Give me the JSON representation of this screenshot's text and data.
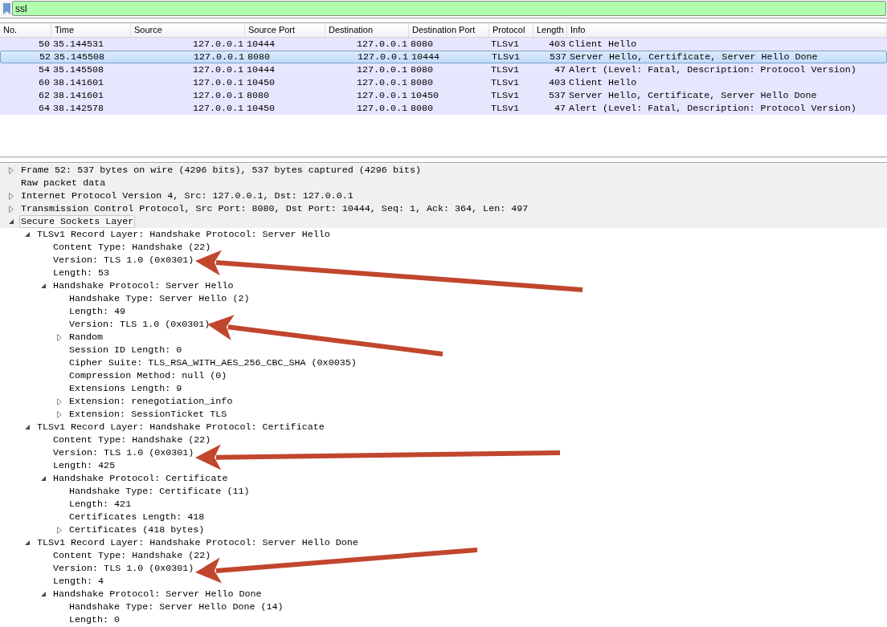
{
  "filter": {
    "value": "ssl"
  },
  "packet_list": {
    "columns": [
      "No.",
      "Time",
      "Source",
      "Source Port",
      "Destination",
      "Destination Port",
      "Protocol",
      "Length",
      "Info"
    ],
    "rows": [
      {
        "selected": false,
        "cells": [
          "50",
          "35.144531",
          "127.0.0.1",
          "10444",
          "127.0.0.1",
          "8080",
          "TLSv1",
          "403",
          "Client Hello"
        ]
      },
      {
        "selected": true,
        "cells": [
          "52",
          "35.145508",
          "127.0.0.1",
          "8080",
          "127.0.0.1",
          "10444",
          "TLSv1",
          "537",
          "Server Hello, Certificate, Server Hello Done"
        ]
      },
      {
        "selected": false,
        "cells": [
          "54",
          "35.145508",
          "127.0.0.1",
          "10444",
          "127.0.0.1",
          "8080",
          "TLSv1",
          "47",
          "Alert (Level: Fatal, Description: Protocol Version)"
        ]
      },
      {
        "selected": false,
        "cells": [
          "60",
          "38.141601",
          "127.0.0.1",
          "10450",
          "127.0.0.1",
          "8080",
          "TLSv1",
          "403",
          "Client Hello"
        ]
      },
      {
        "selected": false,
        "cells": [
          "62",
          "38.141601",
          "127.0.0.1",
          "8080",
          "127.0.0.1",
          "10450",
          "TLSv1",
          "537",
          "Server Hello, Certificate, Server Hello Done"
        ]
      },
      {
        "selected": false,
        "cells": [
          "64",
          "38.142578",
          "127.0.0.1",
          "10450",
          "127.0.0.1",
          "8080",
          "TLSv1",
          "47",
          "Alert (Level: Fatal, Description: Protocol Version)"
        ]
      }
    ]
  },
  "packet_details": [
    {
      "label": "Frame 52: 537 bytes on wire (4296 bits), 537 bytes captured (4296 bits)",
      "expanded": false,
      "selected": false
    },
    {
      "label": "Raw packet data",
      "selected": false
    },
    {
      "label": "Internet Protocol Version 4, Src: 127.0.0.1, Dst: 127.0.0.1",
      "expanded": false,
      "selected": false
    },
    {
      "label": "Transmission Control Protocol, Src Port: 8080, Dst Port: 10444, Seq: 1, Ack: 364, Len: 497",
      "expanded": false,
      "selected": false
    },
    {
      "label": "Secure Sockets Layer",
      "expanded": true,
      "selected": true,
      "children": [
        {
          "label": "TLSv1 Record Layer: Handshake Protocol: Server Hello",
          "expanded": true,
          "children": [
            {
              "label": "Content Type: Handshake (22)"
            },
            {
              "label": "Version: TLS 1.0 (0x0301)"
            },
            {
              "label": "Length: 53"
            },
            {
              "label": "Handshake Protocol: Server Hello",
              "expanded": true,
              "children": [
                {
                  "label": "Handshake Type: Server Hello (2)"
                },
                {
                  "label": "Length: 49"
                },
                {
                  "label": "Version: TLS 1.0 (0x0301)"
                },
                {
                  "label": "Random",
                  "expanded": false
                },
                {
                  "label": "Session ID Length: 0"
                },
                {
                  "label": "Cipher Suite: TLS_RSA_WITH_AES_256_CBC_SHA (0x0035)"
                },
                {
                  "label": "Compression Method: null (0)"
                },
                {
                  "label": "Extensions Length: 9"
                },
                {
                  "label": "Extension: renegotiation_info",
                  "expanded": false
                },
                {
                  "label": "Extension: SessionTicket TLS",
                  "expanded": false
                }
              ]
            }
          ]
        },
        {
          "label": "TLSv1 Record Layer: Handshake Protocol: Certificate",
          "expanded": true,
          "children": [
            {
              "label": "Content Type: Handshake (22)"
            },
            {
              "label": "Version: TLS 1.0 (0x0301)"
            },
            {
              "label": "Length: 425"
            },
            {
              "label": "Handshake Protocol: Certificate",
              "expanded": true,
              "children": [
                {
                  "label": "Handshake Type: Certificate (11)"
                },
                {
                  "label": "Length: 421"
                },
                {
                  "label": "Certificates Length: 418"
                },
                {
                  "label": "Certificates (418 bytes)",
                  "expanded": false
                }
              ]
            }
          ]
        },
        {
          "label": "TLSv1 Record Layer: Handshake Protocol: Server Hello Done",
          "expanded": true,
          "children": [
            {
              "label": "Content Type: Handshake (22)"
            },
            {
              "label": "Version: TLS 1.0 (0x0301)"
            },
            {
              "label": "Length: 4"
            },
            {
              "label": "Handshake Protocol: Server Hello Done",
              "expanded": true,
              "children": [
                {
                  "label": "Handshake Type: Server Hello Done (14)"
                },
                {
                  "label": "Length: 0"
                }
              ]
            }
          ]
        }
      ]
    }
  ]
}
